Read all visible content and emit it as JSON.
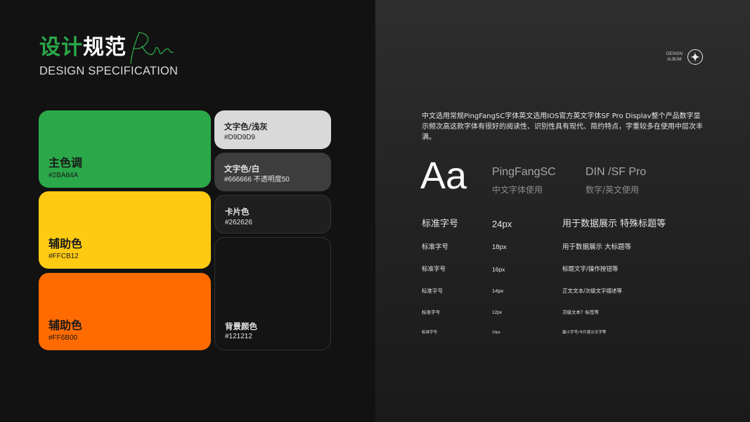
{
  "header": {
    "title_green": "设计",
    "title_white": "规范",
    "subtitle": "DESIGN SPECIFICATION"
  },
  "logo": {
    "line1": "DESIGN",
    "line2": "ALBUM",
    "icon": "sparkle-star-icon"
  },
  "colors": {
    "primary": {
      "name": "主色调",
      "hex": "#2BA84A"
    },
    "secondary_yellow": {
      "name": "辅助色",
      "hex": "#FFCB12"
    },
    "secondary_orange": {
      "name": "辅助色",
      "hex": "#FF6B00"
    },
    "text_light": {
      "name": "文字色/浅灰",
      "hex": "#D9D9D9"
    },
    "text_white": {
      "name": "文字色/白",
      "hex": "#666666 不透明度50"
    },
    "card": {
      "name": "卡片色",
      "hex": "#262626"
    },
    "background": {
      "name": "背景颜色",
      "hex": "#121212"
    }
  },
  "typography": {
    "description": "中文选用常规PingFangSC字体英文选用IOS官方英文字体SF Pro Displav整个产品数字显示频次高这款字体有很好的阅读性、识别性具有现代、简约特点，字重较多在使用中层次丰满。",
    "sample": "Aa",
    "font_a": {
      "name": "PingFangSC",
      "use": "中文字体使用"
    },
    "font_b": {
      "name": "DIN /SF Pro",
      "use": "数字/英文使用"
    },
    "sizes": [
      {
        "label": "标准字号",
        "size": "24px",
        "usage": "用于数据展示 特殊标题等"
      },
      {
        "label": "标准字号",
        "size": "18px",
        "usage": "用于数据展示 大标题等"
      },
      {
        "label": "标准字号",
        "size": "16px",
        "usage": "标题文字/操作按钮等"
      },
      {
        "label": "标准字号",
        "size": "14px",
        "usage": "正文文本/次级文字描述等"
      },
      {
        "label": "标准字号",
        "size": "12px",
        "usage": "次级文本？标签等"
      },
      {
        "label": "标准字号",
        "size": "10px",
        "usage": "最小字号/卡片提示文字等"
      }
    ]
  }
}
